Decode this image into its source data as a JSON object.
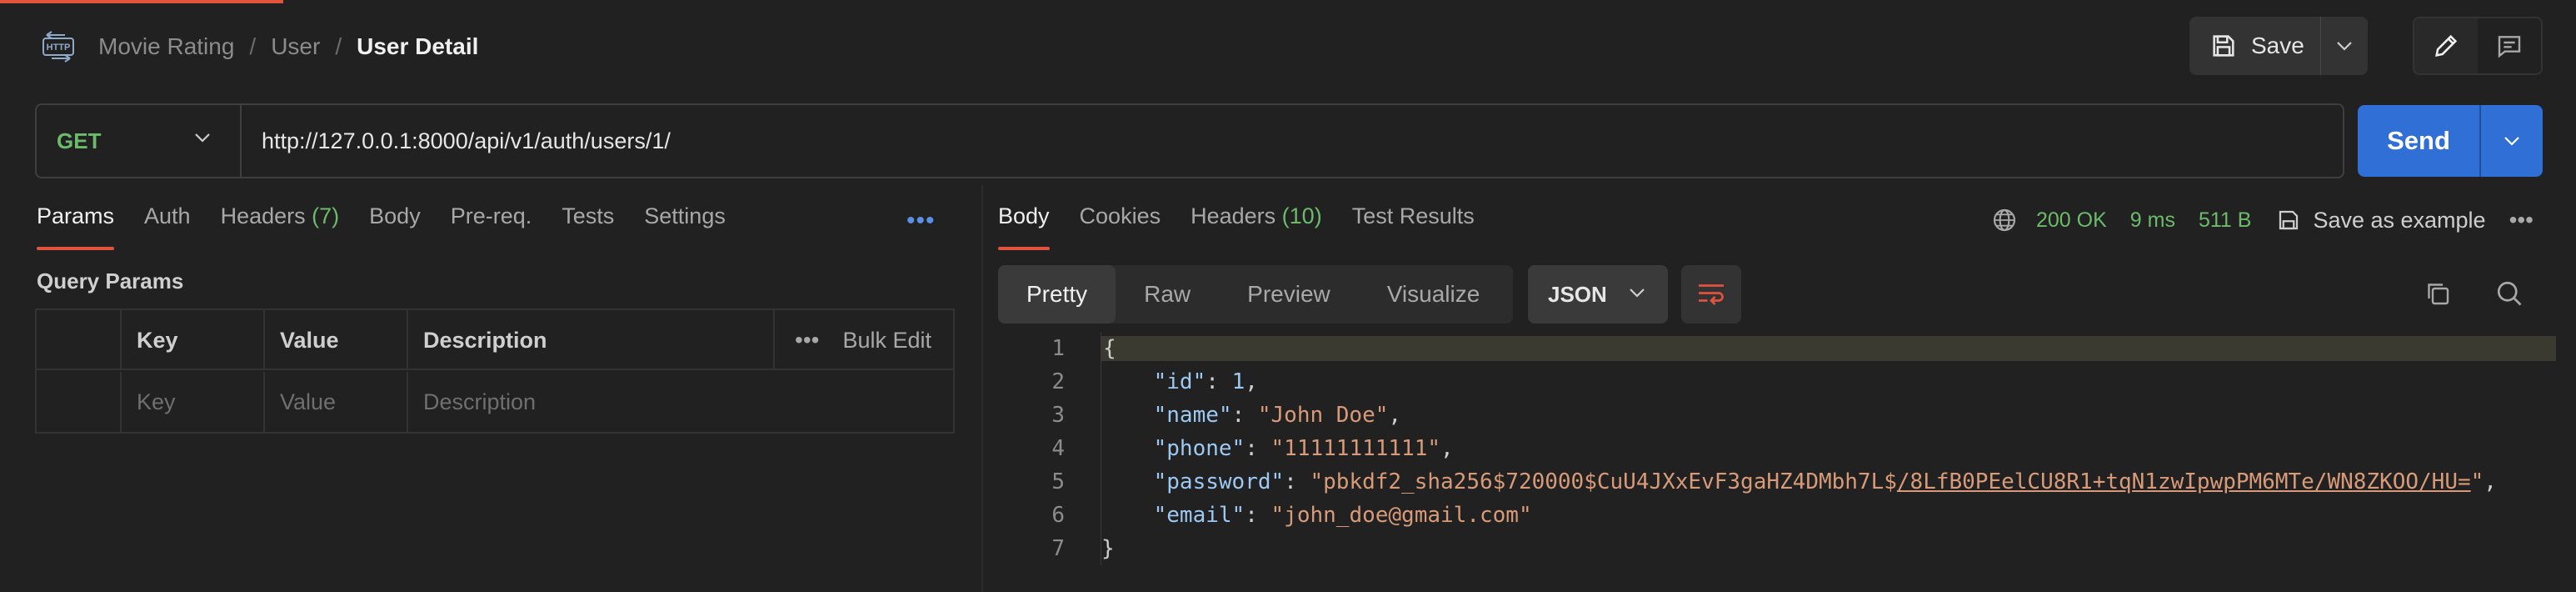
{
  "breadcrumb": {
    "items": [
      "Movie Rating",
      "User"
    ],
    "current": "User Detail"
  },
  "toolbar": {
    "save_label": "Save"
  },
  "request": {
    "method": "GET",
    "url": "http://127.0.0.1:8000/api/v1/auth/users/1/",
    "send_label": "Send"
  },
  "left_tabs": [
    {
      "label": "Params",
      "active": true
    },
    {
      "label": "Auth"
    },
    {
      "label": "Headers",
      "count": "(7)"
    },
    {
      "label": "Body"
    },
    {
      "label": "Pre-req."
    },
    {
      "label": "Tests"
    },
    {
      "label": "Settings"
    }
  ],
  "query_params": {
    "title": "Query Params",
    "headers": [
      "Key",
      "Value",
      "Description"
    ],
    "bulk_edit": "Bulk Edit",
    "placeholders": [
      "Key",
      "Value",
      "Description"
    ]
  },
  "response_tabs": [
    {
      "label": "Body",
      "active": true
    },
    {
      "label": "Cookies"
    },
    {
      "label": "Headers",
      "count": "(10)"
    },
    {
      "label": "Test Results"
    }
  ],
  "status": {
    "code": "200 OK",
    "time": "9 ms",
    "size": "511 B",
    "save_example": "Save as example"
  },
  "view": {
    "tabs": [
      "Pretty",
      "Raw",
      "Preview",
      "Visualize"
    ],
    "active": "Pretty",
    "format": "JSON"
  },
  "response_body": {
    "line_numbers": [
      "1",
      "2",
      "3",
      "4",
      "5",
      "6",
      "7"
    ],
    "id": "1",
    "name": "John Doe",
    "phone": "11111111111",
    "password_plain": "pbkdf2_sha256$720000$CuU4JXxEvF3gaHZ4DMbh7L$",
    "password_link": "/8LfB0PEelCU8R1+tqN1zwIpwpPM6MTe/WN8ZKOO/HU=",
    "email": "john_doe@gmail.com"
  },
  "colors": {
    "accent": "#e0533d",
    "primary": "#2f6fd6",
    "success": "#6bbb6b",
    "json_key": "#9cc8f2",
    "json_string": "#d89a78"
  }
}
